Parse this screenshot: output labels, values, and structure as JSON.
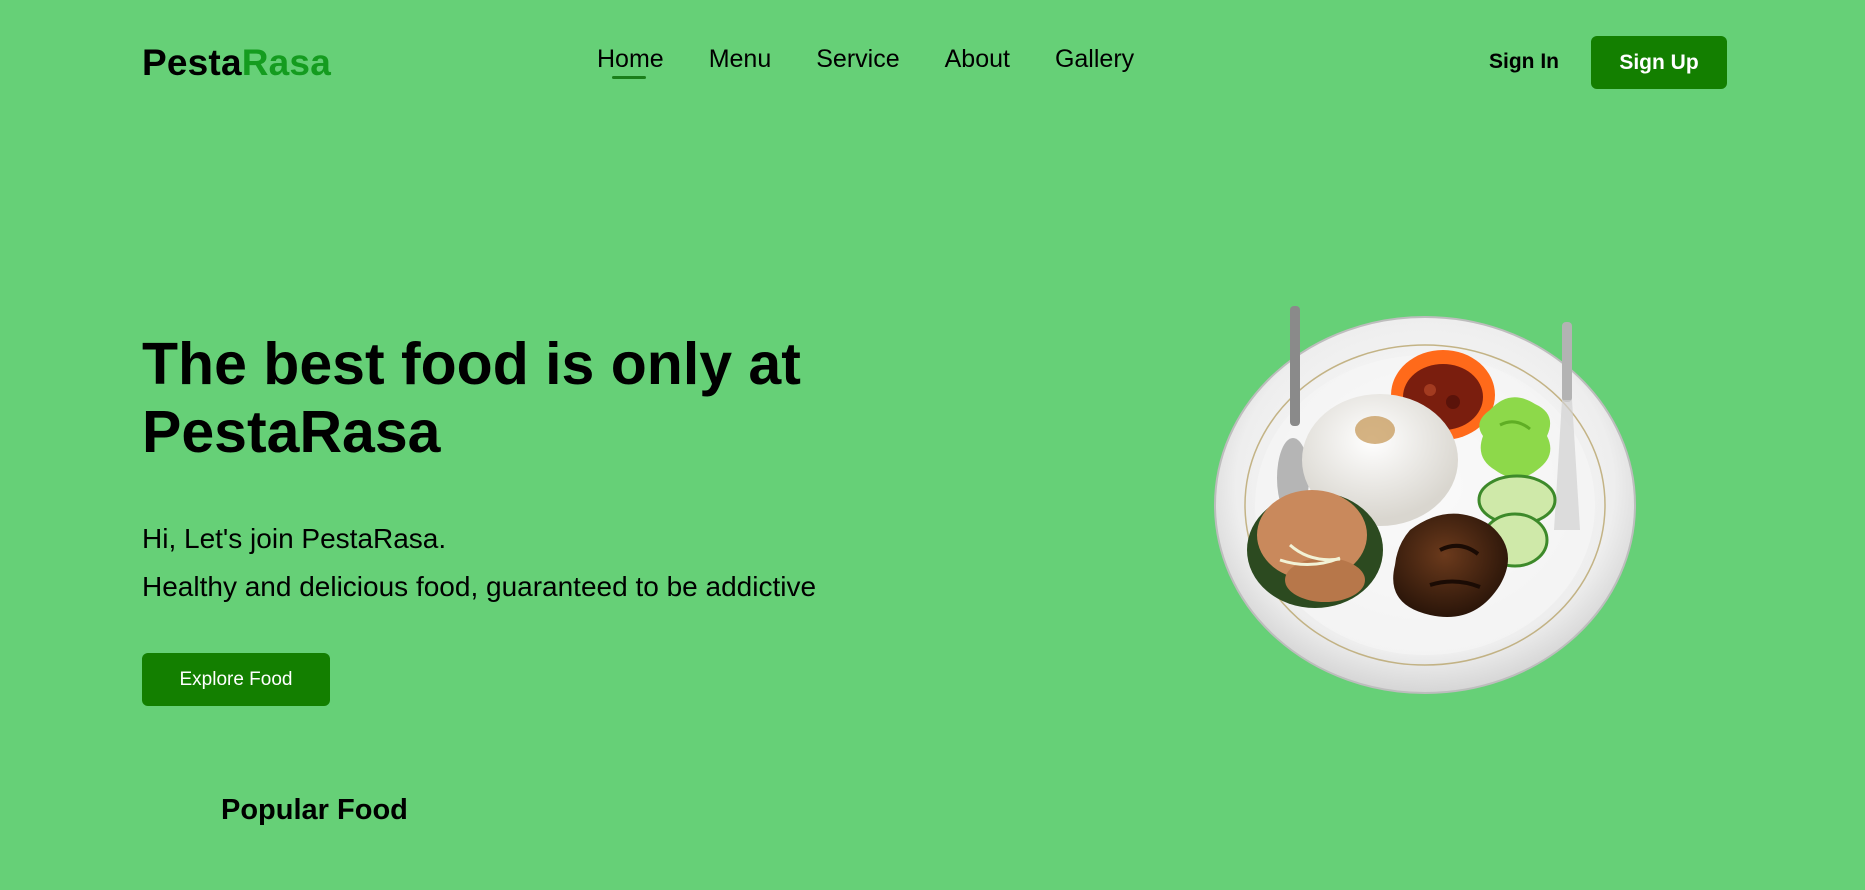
{
  "brand": {
    "part1": "Pesta",
    "part2": "Rasa"
  },
  "nav": {
    "items": [
      {
        "label": "Home",
        "active": true
      },
      {
        "label": "Menu",
        "active": false
      },
      {
        "label": "Service",
        "active": false
      },
      {
        "label": "About",
        "active": false
      },
      {
        "label": "Gallery",
        "active": false
      }
    ]
  },
  "auth": {
    "sign_in": "Sign In",
    "sign_up": "Sign Up"
  },
  "hero": {
    "title_line1": "The best food is only at",
    "title_line2": "PestaRasa",
    "subtitle_line1": "Hi, Let's join PestaRasa.",
    "subtitle_line2": "Healthy and delicious food, guaranteed to be addictive",
    "cta": "Explore Food"
  },
  "sections": {
    "popular_title": "Popular Food"
  },
  "colors": {
    "background": "#66d077",
    "brand_accent": "#149c1f",
    "button": "#137f00"
  },
  "hero_image": {
    "subject": "plate-of-food"
  }
}
